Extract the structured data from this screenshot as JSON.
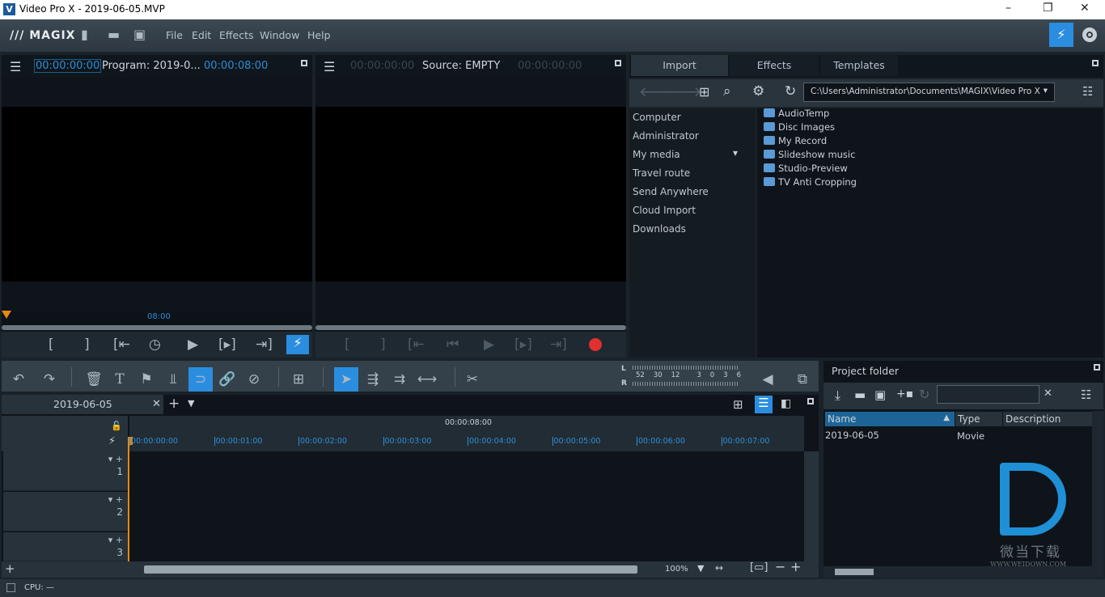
{
  "window": {
    "title": "Video Pro X - 2019-06-05.MVP",
    "minimize": "–",
    "maximize": "❐",
    "close": "✕"
  },
  "menubar": {
    "logo": "/// MAGIX",
    "items": [
      "File",
      "Edit",
      "Effects",
      "Window",
      "Help"
    ]
  },
  "program_monitor": {
    "timecode": "00:00:00:00",
    "title": "Program: 2019-0...",
    "duration": "00:00:08:00",
    "ruler_label": "08:00"
  },
  "source_monitor": {
    "timecode": "00:00:00:00",
    "title": "Source: EMPTY",
    "duration": "00:00:00:00"
  },
  "media_pool": {
    "tabs": [
      "Import",
      "Effects",
      "Templates"
    ],
    "active_tab": 0,
    "path": "C:\\Users\\Administrator\\Documents\\MAGIX\\Video Pro X",
    "nav": [
      "Computer",
      "Administrator",
      "My media",
      "Travel route",
      "Send Anywhere",
      "Cloud Import",
      "Downloads"
    ],
    "files": [
      "AudioTemp",
      "Disc Images",
      "My Record",
      "Slideshow music",
      "Studio-Preview",
      "TV Anti Cropping"
    ]
  },
  "meter": {
    "left": "L",
    "right": "R",
    "scale": [
      "52",
      "30",
      "12",
      "3",
      "0",
      "3",
      "6"
    ]
  },
  "timeline": {
    "tab": "2019-06-05",
    "total": "00:00:08:00",
    "ticks": [
      "00:00:00:00",
      "00:00:01:00",
      "00:00:02:00",
      "00:00:03:00",
      "00:00:04:00",
      "00:00:05:00",
      "00:00:06:00",
      "00:00:07:00"
    ],
    "tracks": [
      "1",
      "2",
      "3"
    ],
    "zoom": "100%"
  },
  "project_folder": {
    "title": "Project folder",
    "search": "",
    "columns": [
      "Name",
      "Type",
      "Description"
    ],
    "rows": [
      {
        "name": "2019-06-05",
        "type": "Movie",
        "description": ""
      }
    ]
  },
  "watermark": {
    "text": "微当下载",
    "url": "WWW.WEIDOWN.COM"
  },
  "status": {
    "cpu": "CPU: —"
  },
  "colors": {
    "accent": "#2a8de0",
    "playhead": "#e58a13",
    "record": "#e03030"
  }
}
